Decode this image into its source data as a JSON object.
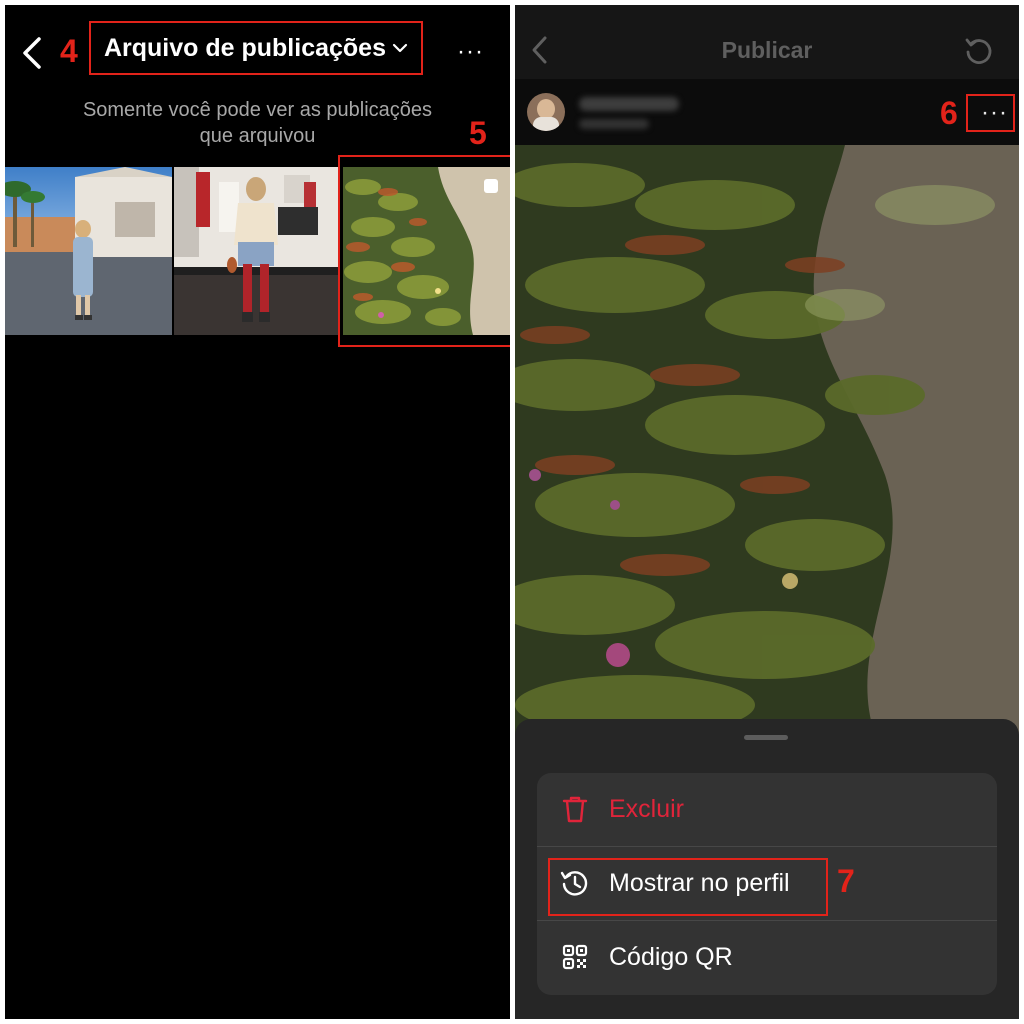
{
  "left": {
    "title": "Arquivo de publicações",
    "more_label": "···",
    "subtitle_line1": "Somente você pode ver as publicações",
    "subtitle_line2": "que arquivou",
    "annotations": [
      "4",
      "5"
    ]
  },
  "right": {
    "title": "Publicar",
    "more_label": "···",
    "annotations": [
      "6",
      "7"
    ],
    "menu": [
      {
        "label": "Excluir",
        "icon": "trash-icon",
        "color": "#e0243a"
      },
      {
        "label": "Mostrar no perfil",
        "icon": "history-icon",
        "color": "#ffffff"
      },
      {
        "label": "Código QR",
        "icon": "qr-code-icon",
        "color": "#ffffff"
      }
    ]
  },
  "colors": {
    "annotation_red": "#e2231a",
    "destructive": "#e0243a",
    "background": "#000000",
    "sheet": "#262626"
  }
}
